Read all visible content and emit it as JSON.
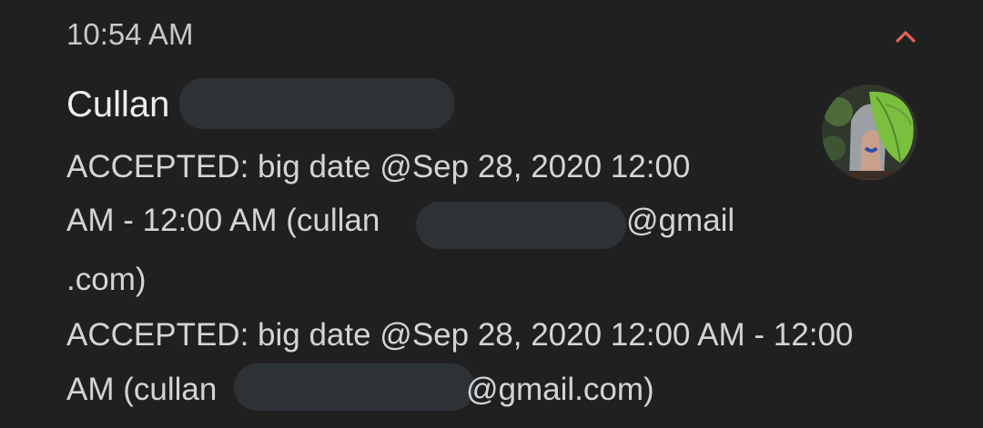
{
  "notification": {
    "time": "10:54 AM",
    "sender": "Cullan",
    "lines": [
      "ACCEPTED: big date @Sep 28, 2020 12:00",
      "AM - 12:00 AM (cullan",
      "@gmail",
      ".com)",
      "ACCEPTED: big date @Sep 28, 2020 12:00 AM - 12:00",
      "AM (cullan",
      "@gmail.com)"
    ],
    "icons": {
      "collapse": "chevron-up-icon",
      "avatar": "profile-photo"
    },
    "colors": {
      "background": "#202020",
      "accent": "#e0645c",
      "redaction": "#2d3237"
    }
  }
}
